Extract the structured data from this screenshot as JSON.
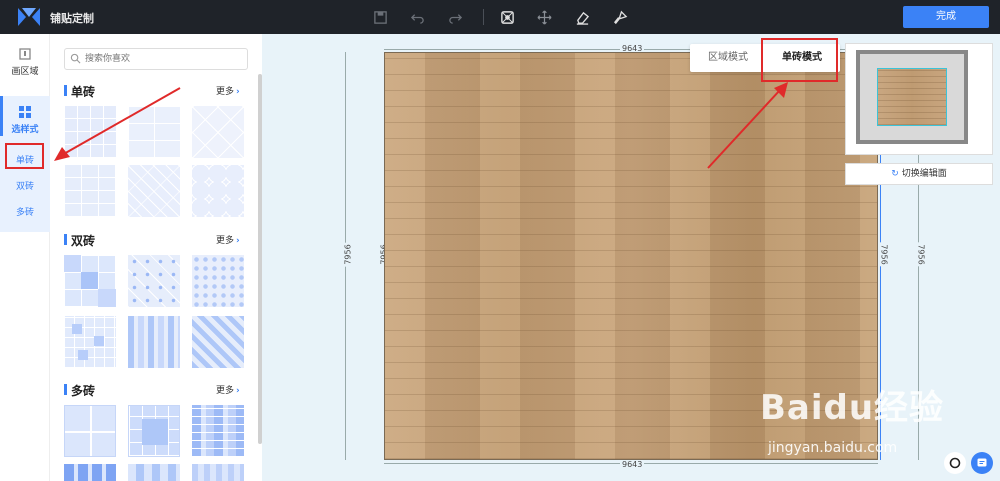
{
  "header": {
    "app_title": "铺贴定制",
    "done_label": "完成",
    "tools": [
      "save-icon",
      "undo-icon",
      "redo-icon",
      "tile-pattern-icon",
      "move-icon",
      "eraser-icon",
      "brush-icon"
    ]
  },
  "rail": {
    "draw_area_label": "画区域",
    "choose_style_label": "选样式",
    "sub_items": [
      "单砖",
      "双砖",
      "多砖"
    ]
  },
  "panel": {
    "search_placeholder": "搜索你喜欢",
    "sections": [
      {
        "title": "单砖",
        "more": "更多"
      },
      {
        "title": "双砖",
        "more": "更多"
      },
      {
        "title": "多砖",
        "more": "更多"
      }
    ]
  },
  "canvas": {
    "dim_top": "9643",
    "dim_bottom": "9643",
    "dim_left_outer": "7956",
    "dim_left_inner": "7956",
    "dim_right_inner": "7956",
    "dim_right_outer": "7956",
    "mode_tabs": [
      "区域模式",
      "单砖模式"
    ],
    "active_mode": "单砖模式",
    "switch_label": "切换编辑面"
  },
  "watermark": {
    "brand": "Baidu经验",
    "url": "jingyan.baidu.com"
  },
  "colors": {
    "accent": "#3b82f6",
    "topbar": "#1f2329",
    "annotation_red": "#e02a2a"
  }
}
